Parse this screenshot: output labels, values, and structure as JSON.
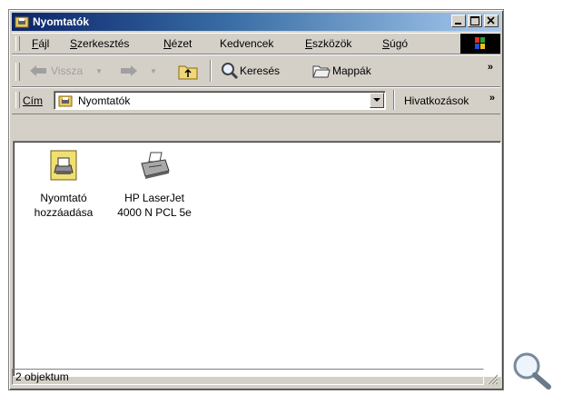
{
  "window": {
    "title": "Nyomtatók"
  },
  "menubar": {
    "items": [
      {
        "label": "Fájl",
        "ul": "F",
        "rest": "ájl"
      },
      {
        "label": "Szerkesztés",
        "ul": "S",
        "pre": "",
        "rest": "zerkesztés"
      },
      {
        "label": "Nézet",
        "ul": "N",
        "rest": "ézet"
      },
      {
        "label": "Kedvencek"
      },
      {
        "label": "Eszközök",
        "ul": "E",
        "rest": "szközök"
      },
      {
        "label": "Súgó",
        "ul": "S",
        "rest": "úgó"
      }
    ]
  },
  "toolbar": {
    "back_label": "Vissza",
    "search_label": "Keresés",
    "folders_label": "Mappák"
  },
  "address": {
    "label": "Cím",
    "value": "Nyomtatók",
    "links_label": "Hivatkozások"
  },
  "items": [
    {
      "line1": "Nyomtató",
      "line2": "hozzáadása"
    },
    {
      "line1": "HP LaserJet",
      "line2": "4000 N PCL 5e"
    }
  ],
  "status": {
    "text": "2 objektum"
  },
  "colors": {
    "title_start": "#0a246a",
    "title_end": "#a6caf0",
    "face": "#d4d0c8"
  }
}
